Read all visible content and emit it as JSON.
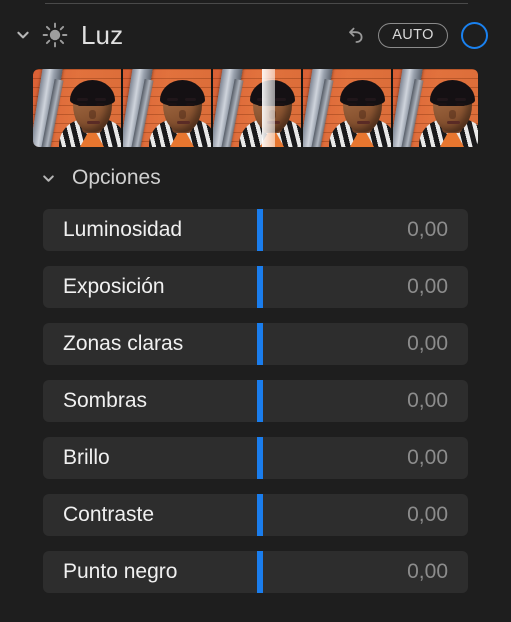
{
  "section": {
    "title": "Luz",
    "icon": "sun-icon",
    "disclosure_state": "expanded",
    "reset_icon": "undo-arrow-icon",
    "auto_label": "AUTO",
    "toggle_icon": "circle-toggle-icon",
    "accent_color": "#1a81ef"
  },
  "filmstrip": {
    "name": "light-preview-filmstrip",
    "thumbnail_count": 5,
    "selected_index": 2,
    "thumbnails": [
      {
        "alt": "light-preview-1"
      },
      {
        "alt": "light-preview-2"
      },
      {
        "alt": "light-preview-3"
      },
      {
        "alt": "light-preview-4"
      },
      {
        "alt": "light-preview-5"
      }
    ]
  },
  "options": {
    "title": "Opciones",
    "disclosure_state": "expanded"
  },
  "sliders": [
    {
      "label": "Luminosidad",
      "value": "0,00"
    },
    {
      "label": "Exposición",
      "value": "0,00"
    },
    {
      "label": "Zonas claras",
      "value": "0,00"
    },
    {
      "label": "Sombras",
      "value": "0,00"
    },
    {
      "label": "Brillo",
      "value": "0,00"
    },
    {
      "label": "Contraste",
      "value": "0,00"
    },
    {
      "label": "Punto negro",
      "value": "0,00"
    }
  ]
}
